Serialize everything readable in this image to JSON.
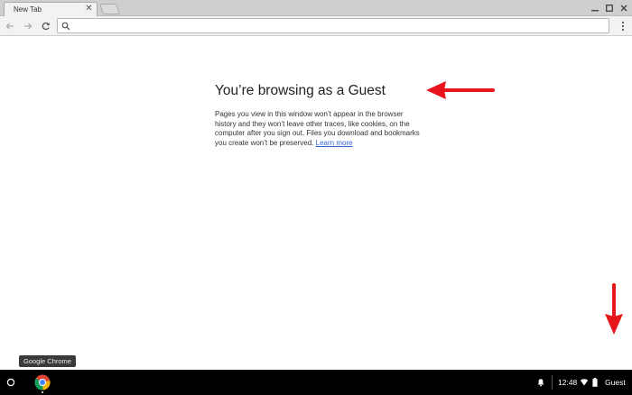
{
  "tab": {
    "title": "New Tab",
    "close_icon": "close-icon"
  },
  "omnibox": {
    "value": "",
    "placeholder": "",
    "icon": "search-icon"
  },
  "guest_page": {
    "title": "You’re browsing as a Guest",
    "body": "Pages you view in this window won’t appear in the browser history and they won’t leave other traces, like cookies, on the computer after you sign out. Files you download and bookmarks you create won’t be preserved.",
    "learn_more": "Learn more"
  },
  "tooltip": {
    "text": "Google Chrome"
  },
  "shelf": {
    "time": "12:48",
    "user": "Guest"
  },
  "colors": {
    "annotation_arrow": "#e8141b",
    "link": "#3367d6",
    "shelf": "#000000"
  }
}
